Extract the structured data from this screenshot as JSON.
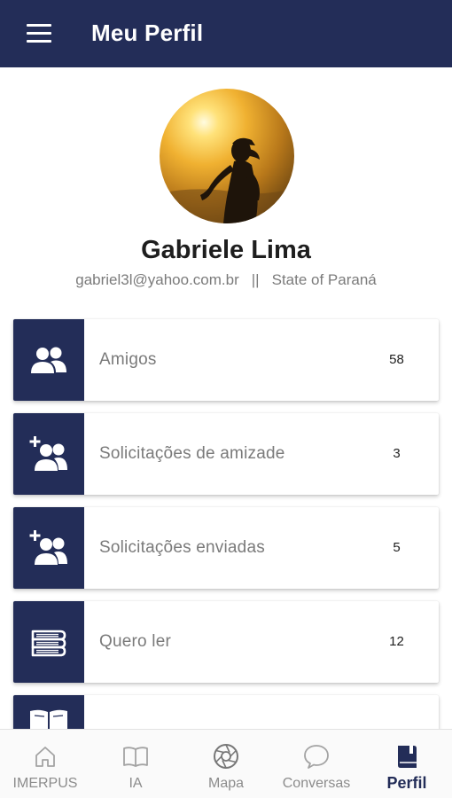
{
  "header": {
    "title": "Meu Perfil"
  },
  "profile": {
    "name": "Gabriele Lima",
    "email": "gabriel3l@yahoo.com.br",
    "separator": "||",
    "location": "State of Paraná"
  },
  "menu": [
    {
      "label": "Amigos",
      "count": "58",
      "icon": "friends-icon"
    },
    {
      "label": "Solicitações de amizade",
      "count": "3",
      "icon": "add-friend-icon"
    },
    {
      "label": "Solicitações enviadas",
      "count": "5",
      "icon": "add-friend-icon"
    },
    {
      "label": "Quero ler",
      "count": "12",
      "icon": "books-stack-icon"
    },
    {
      "label": "",
      "count": "",
      "icon": "open-book-icon"
    }
  ],
  "bottom_nav": [
    {
      "label": "IMERPUS",
      "icon": "home-icon",
      "active": false
    },
    {
      "label": "IA",
      "icon": "book-icon",
      "active": false
    },
    {
      "label": "Mapa",
      "icon": "aperture-icon",
      "active": false
    },
    {
      "label": "Conversas",
      "icon": "chat-bubble-icon",
      "active": false
    },
    {
      "label": "Perfil",
      "icon": "profile-book-icon",
      "active": true
    }
  ],
  "colors": {
    "primary": "#232d58",
    "background": "#ffffff",
    "muted_text": "#7a7a7a"
  }
}
